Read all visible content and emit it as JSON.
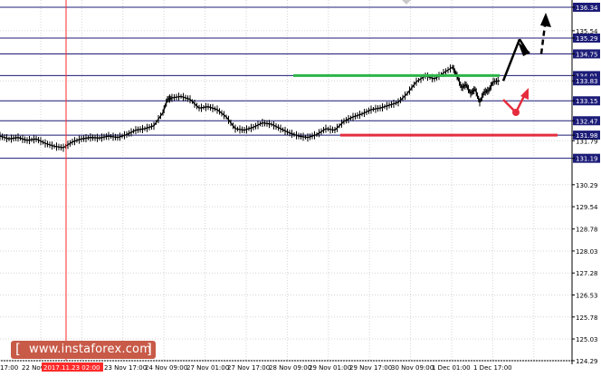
{
  "chart_data": {
    "type": "candlestick",
    "instrument_note": "",
    "y_axis": {
      "min": 124.29,
      "max": 136.34,
      "tick_labels": [
        "136.34",
        "135.54",
        "135.29",
        "134.75",
        "134.01",
        "133.83",
        "133.15",
        "132.47",
        "131.98",
        "131.79",
        "131.19",
        "130.29",
        "129.54",
        "128.78",
        "128.03",
        "127.28",
        "126.53",
        "125.78",
        "125.03",
        "124.29"
      ],
      "scale": "linear"
    },
    "x_axis": {
      "tick_labels": [
        "17:00",
        "22 Nov",
        "2017.11.23 02:00",
        "23 Nov 17:00",
        "24 Nov 09:00",
        "27 Nov 01:00",
        "27 Nov 17:00",
        "28 Nov 09:00",
        "29 Nov 01:00",
        "29 Nov 17:00",
        "30 Nov 09:00",
        "1 Dec 01:00",
        "1 Dec 17:00"
      ],
      "highlighted_label": "2017.11.23 02:00"
    },
    "grid": true,
    "horizontal_levels": [
      136.34,
      135.29,
      134.75,
      134.01,
      133.15,
      132.47,
      131.98,
      131.19
    ],
    "level_labels_highlighted": [
      "136.34",
      "135.29",
      "134.75",
      "134.01",
      "133.83",
      "133.15",
      "132.47",
      "131.98",
      "131.19"
    ],
    "current_price": 133.83,
    "price_series": {
      "description_points": [
        [
          0,
          131.95
        ],
        [
          10,
          131.85
        ],
        [
          20,
          131.9
        ],
        [
          30,
          131.8
        ],
        [
          40,
          131.85
        ],
        [
          50,
          131.7
        ],
        [
          60,
          131.6
        ],
        [
          70,
          131.55
        ],
        [
          80,
          131.75
        ],
        [
          90,
          131.85
        ],
        [
          100,
          131.9
        ],
        [
          110,
          131.88
        ],
        [
          120,
          131.95
        ],
        [
          130,
          131.9
        ],
        [
          140,
          132.0
        ],
        [
          150,
          132.15
        ],
        [
          160,
          132.2
        ],
        [
          170,
          132.3
        ],
        [
          180,
          132.75
        ],
        [
          185,
          133.2
        ],
        [
          190,
          133.25
        ],
        [
          200,
          133.3
        ],
        [
          210,
          133.2
        ],
        [
          220,
          132.9
        ],
        [
          230,
          132.95
        ],
        [
          240,
          132.85
        ],
        [
          250,
          132.6
        ],
        [
          260,
          132.2
        ],
        [
          270,
          132.15
        ],
        [
          280,
          132.25
        ],
        [
          290,
          132.4
        ],
        [
          300,
          132.35
        ],
        [
          310,
          132.2
        ],
        [
          320,
          132.05
        ],
        [
          330,
          131.95
        ],
        [
          340,
          131.9
        ],
        [
          350,
          132.0
        ],
        [
          360,
          132.2
        ],
        [
          370,
          132.15
        ],
        [
          380,
          132.45
        ],
        [
          390,
          132.6
        ],
        [
          400,
          132.7
        ],
        [
          410,
          132.85
        ],
        [
          420,
          132.9
        ],
        [
          430,
          133.0
        ],
        [
          440,
          133.1
        ],
        [
          450,
          133.4
        ],
        [
          460,
          133.8
        ],
        [
          470,
          134.0
        ],
        [
          480,
          133.9
        ],
        [
          490,
          134.1
        ],
        [
          500,
          134.3
        ],
        [
          505,
          134.0
        ],
        [
          510,
          133.6
        ],
        [
          515,
          133.7
        ],
        [
          520,
          133.4
        ],
        [
          525,
          133.55
        ],
        [
          530,
          133.1
        ],
        [
          535,
          133.45
        ],
        [
          540,
          133.5
        ],
        [
          545,
          133.8
        ],
        [
          552,
          133.83
        ]
      ]
    },
    "annotations": {
      "resistance_line": {
        "price": 134.01,
        "color": "#2db54a"
      },
      "support_line": {
        "price": 131.98,
        "color": "#e52d3d"
      },
      "vertical_marker_label": "2017.11.23 02:00",
      "vertical_marker_color": "#ff2a2a",
      "forecast_arrows": [
        {
          "color": "#000000",
          "path_prices": [
            133.83,
            135.25,
            134.75,
            136.2
          ]
        },
        {
          "color": "#e52d3d",
          "path_prices": [
            133.83,
            133.15,
            133.6
          ]
        }
      ]
    }
  },
  "watermark": {
    "text": "www.instaforex.com",
    "open_bracket": "[",
    "close_bracket": "]"
  },
  "colors": {
    "background": "#ffffff",
    "grid": "#d6d6d6",
    "level_line": "#1c1c78",
    "axis_label_box": "#1c1c78",
    "label_text_highlighted": "#ffffff",
    "candles": "#000000"
  }
}
